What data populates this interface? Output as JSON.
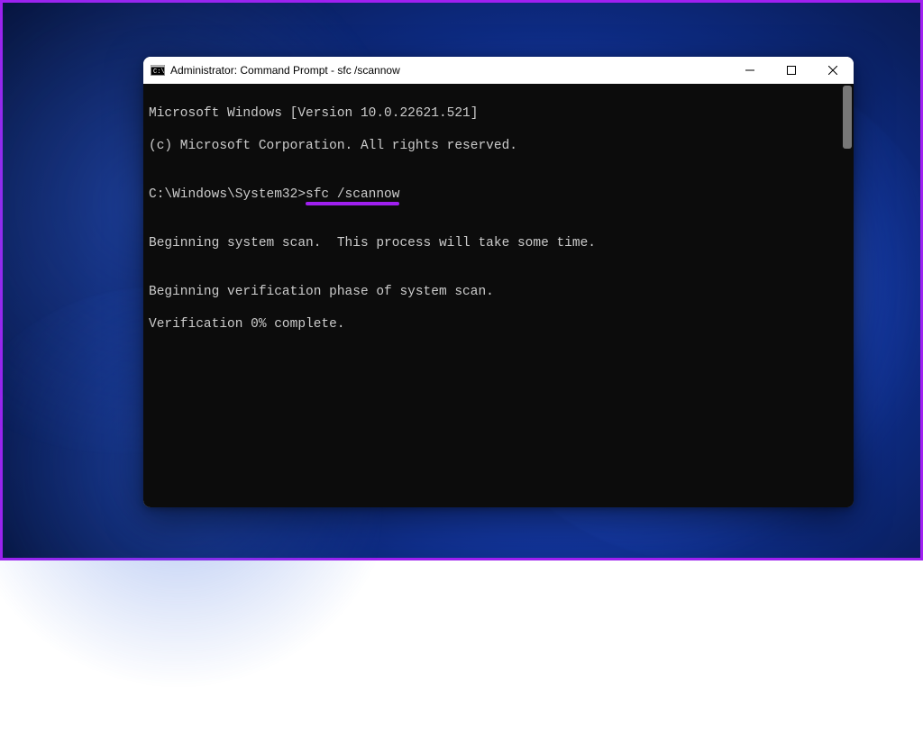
{
  "window": {
    "title": "Administrator: Command Prompt - sfc  /scannow"
  },
  "terminal": {
    "line1": "Microsoft Windows [Version 10.0.22621.521]",
    "line2": "(c) Microsoft Corporation. All rights reserved.",
    "blank1": "",
    "prompt_prefix": "C:\\Windows\\System32>",
    "prompt_cmd": "sfc /scannow",
    "blank2": "",
    "line4": "Beginning system scan.  This process will take some time.",
    "blank3": "",
    "line5": "Beginning verification phase of system scan.",
    "line6": "Verification 0% complete."
  },
  "annotation": {
    "highlight_color": "#a020f0"
  }
}
